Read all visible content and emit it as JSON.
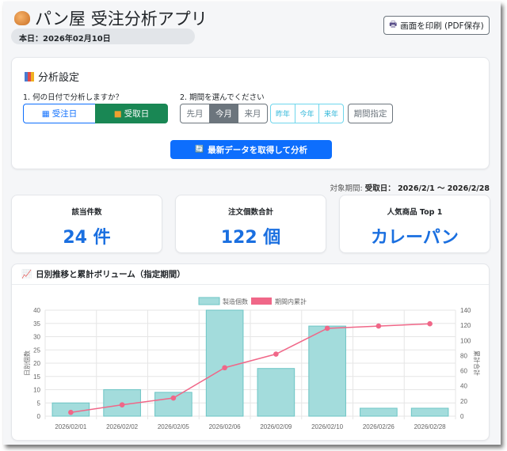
{
  "header": {
    "title": "パン屋 受注分析アプリ",
    "today": "本日：2026年02月10日",
    "print_label": "画面を印刷 (PDF保存)"
  },
  "settings": {
    "title": "分析設定",
    "q1": "1. 何の日付で分析しますか？",
    "q2": "2. 期間を選んでください",
    "date_types": [
      {
        "label": "受注日",
        "active": false
      },
      {
        "label": "受取日",
        "active": true
      }
    ],
    "months": [
      "先月",
      "今月",
      "来月"
    ],
    "active_month": "今月",
    "years": [
      "昨年",
      "今年",
      "来年"
    ],
    "custom": "期間指定",
    "fetch_label": "最新データを取得して分析"
  },
  "period": {
    "prefix": "対象期間: ",
    "value": "受取日： 2026/2/1 〜 2026/2/28"
  },
  "kpis": [
    {
      "title": "該当件数",
      "value": "24 件"
    },
    {
      "title": "注文個数合計",
      "value": "122 個"
    },
    {
      "title": "人気商品 Top 1",
      "value": "カレーパン"
    }
  ],
  "chart_title": "日別推移と累計ボリューム（指定期間）",
  "colors": {
    "bar": "#a3dcdc",
    "bar_border": "#6cc5c5",
    "line": "#f06788",
    "accent": "#0d6efd",
    "green": "#198754"
  },
  "chart_data": {
    "type": "bar",
    "categories": [
      "2026/02/01",
      "2026/02/02",
      "2026/02/05",
      "2026/02/06",
      "2026/02/09",
      "2026/02/10",
      "2026/02/26",
      "2026/02/28"
    ],
    "series": [
      {
        "name": "製造個数",
        "type": "bar",
        "axis": "left",
        "values": [
          5,
          10,
          9,
          40,
          18,
          34,
          3,
          3
        ]
      },
      {
        "name": "期間内累計",
        "type": "line",
        "axis": "right",
        "values": [
          5,
          15,
          24,
          64,
          82,
          116,
          119,
          122
        ]
      }
    ],
    "ylabel": "日別個数",
    "y2label": "累計合計",
    "ylim": [
      0,
      40
    ],
    "y2lim": [
      0,
      140
    ],
    "yticks": [
      0,
      5,
      10,
      15,
      20,
      25,
      30,
      35,
      40
    ],
    "y2ticks": [
      0,
      20,
      40,
      60,
      80,
      100,
      120,
      140
    ],
    "legend": "top",
    "grid": true
  }
}
